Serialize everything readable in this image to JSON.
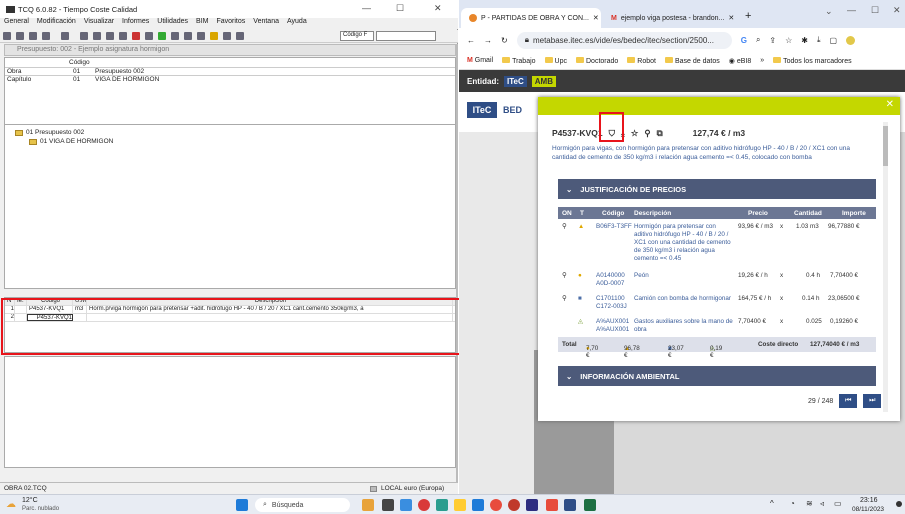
{
  "left_app": {
    "title": "TCQ 6.0.82 - Tiempo Coste Calidad",
    "menu": [
      "General",
      "Modificación",
      "Visualizar",
      "Informes",
      "Utilidades",
      "BIM",
      "Favoritos",
      "Ventana",
      "Ayuda"
    ],
    "codigo_select": "Código F",
    "subwindow_title": "Presupuesto: 002 - Ejemplo asignatura hormigon",
    "codigo_header": "Código",
    "obra_label": "Obra",
    "obra_code": "01",
    "obra_name": "Presupuesto 002",
    "capitulo_label": "Capítulo",
    "capitulo_code": "01",
    "capitulo_name": "VIGA DE HORMIGON",
    "tree_root": "01 Presupuesto 002",
    "tree_child": "01 VIGA DE HORMIGON",
    "grid_headers": [
      "Nº",
      "Ie.",
      "Código",
      "U.M.",
      "Descripción"
    ],
    "grid_rows": [
      {
        "n": "1",
        "code": "P4537-KVQ1",
        "um": "m3",
        "desc": "Horm.p/viga hormigón para pretensar +adit. hidrófugo HP - 40 / B / 20 / XC1 cant.cemento 350kg/m3, a"
      },
      {
        "n": "2",
        "code": "P4537-KVQ1",
        "um": "",
        "desc": ""
      }
    ],
    "status_left": "OBRA 02.TCQ",
    "status_local": "LOCAL",
    "status_currency": "euro (Europa)"
  },
  "browser": {
    "tab1": "P - PARTIDAS DE OBRA Y CON...",
    "tab2": "ejemplo viga postesa - brandon...",
    "url": "metabase.itec.es/vide/es/bedec/itec/section/2500...",
    "bookmarks": [
      "Gmail",
      "Trabajo",
      "Upc",
      "Doctorado",
      "Robot",
      "Base de datos",
      "eBI8"
    ],
    "bookmarks_more": "»",
    "bookmarks_all": "Todos los marcadores",
    "entidad_label": "Entidad:",
    "entidad_itec": "ITeC",
    "entidad_amb": "AMB",
    "itec_logo": "ITeC",
    "bed": "BED"
  },
  "modal": {
    "code": "P4537-KVQ1",
    "price": "127,74 € / m3",
    "description": "Hormigón para vigas, con hormigón para pretensar con aditivo hidrófugo HP - 40 / B / 20 / XC1 con una cantidad de cemento de 350 kg/m3 i relación agua cemento =< 0.45, colocado con bomba",
    "section1": "JUSTIFICACIÓN DE PRECIOS",
    "section2": "INFORMACIÓN AMBIENTAL",
    "table_headers": [
      "ON",
      "T",
      "Código",
      "Descripción",
      "Precio",
      "Cantidad",
      "Importe"
    ],
    "rows": [
      {
        "code": "B06F3-T3FF",
        "desc": "Hormigón para pretensar con aditivo hidrófugo HP - 40 / B / 20 / XC1 con una cantidad de cemento de 350 kg/m3 i relación agua cemento =< 0.45",
        "price": "93,96 € / m3",
        "x": "x",
        "qty": "1.03 m3",
        "imp": "96,77880 €"
      },
      {
        "code": "A0140000",
        "code2": "A0D-0007",
        "desc": "Peón",
        "price": "19,26 € / h",
        "x": "x",
        "qty": "0.4 h",
        "imp": "7,70400 €"
      },
      {
        "code": "C1701100",
        "code2": "C172-003J",
        "desc": "Camión con bomba de hormigonar",
        "price": "164,75 € / h",
        "x": "x",
        "qty": "0.14 h",
        "imp": "23,06500 €"
      },
      {
        "code": "A%AUX001",
        "code2": "A%AUX001",
        "desc": "Gastos auxiliares sobre la mano de obra",
        "price": "7,70400 €",
        "x": "x",
        "qty": "0.025",
        "imp": "0,19260 €"
      }
    ],
    "total_label": "Total",
    "total_mo": "7,70 €",
    "total_mat": "96,78 €",
    "total_maq": "23,07 €",
    "total_aux": "0,19 €",
    "coste_label": "Coste directo",
    "coste_value": "127,74040 € / m3",
    "page": "29 / 248"
  },
  "taskbar": {
    "weather_temp": "12°C",
    "weather_desc": "Parc. nublado",
    "search": "Búsqueda",
    "time": "23:16",
    "date": "08/11/2023"
  }
}
